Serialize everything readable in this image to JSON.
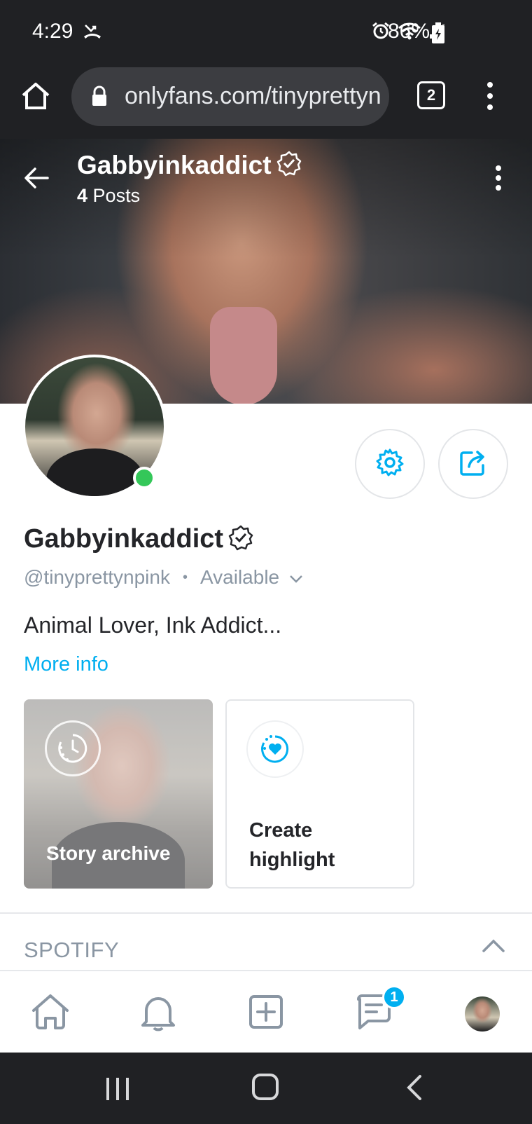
{
  "status_bar": {
    "time": "4:29",
    "battery": "86%",
    "icons": [
      "missed-call-icon",
      "alarm-icon",
      "wifi-icon",
      "signal-icon",
      "battery-charging-icon"
    ]
  },
  "browser": {
    "url": "onlyfans.com/tinyprettyn",
    "tab_count": "2",
    "icons": [
      "home-icon",
      "lock-icon",
      "tabs-icon",
      "more-vertical-icon"
    ]
  },
  "cover": {
    "name": "Gabbyinkaddict",
    "posts_count": "4",
    "posts_label": "Posts"
  },
  "profile": {
    "name": "Gabbyinkaddict",
    "handle": "@tinyprettynpink",
    "separator": "•",
    "status": "Available",
    "bio": "Animal Lover, Ink Addict...",
    "more_info": "More info",
    "online": true
  },
  "stories": {
    "archive_label": "Story archive",
    "create_label": "Create highlight"
  },
  "sections": {
    "spotify": "SPOTIFY"
  },
  "bottom_nav": {
    "items": [
      "home",
      "notifications",
      "add-post",
      "messages",
      "profile"
    ],
    "messages_badge": "1"
  },
  "colors": {
    "accent": "#00aff0",
    "online": "#34c759",
    "muted": "#8a96a3",
    "text": "#242529",
    "chrome_bg": "#202124"
  }
}
